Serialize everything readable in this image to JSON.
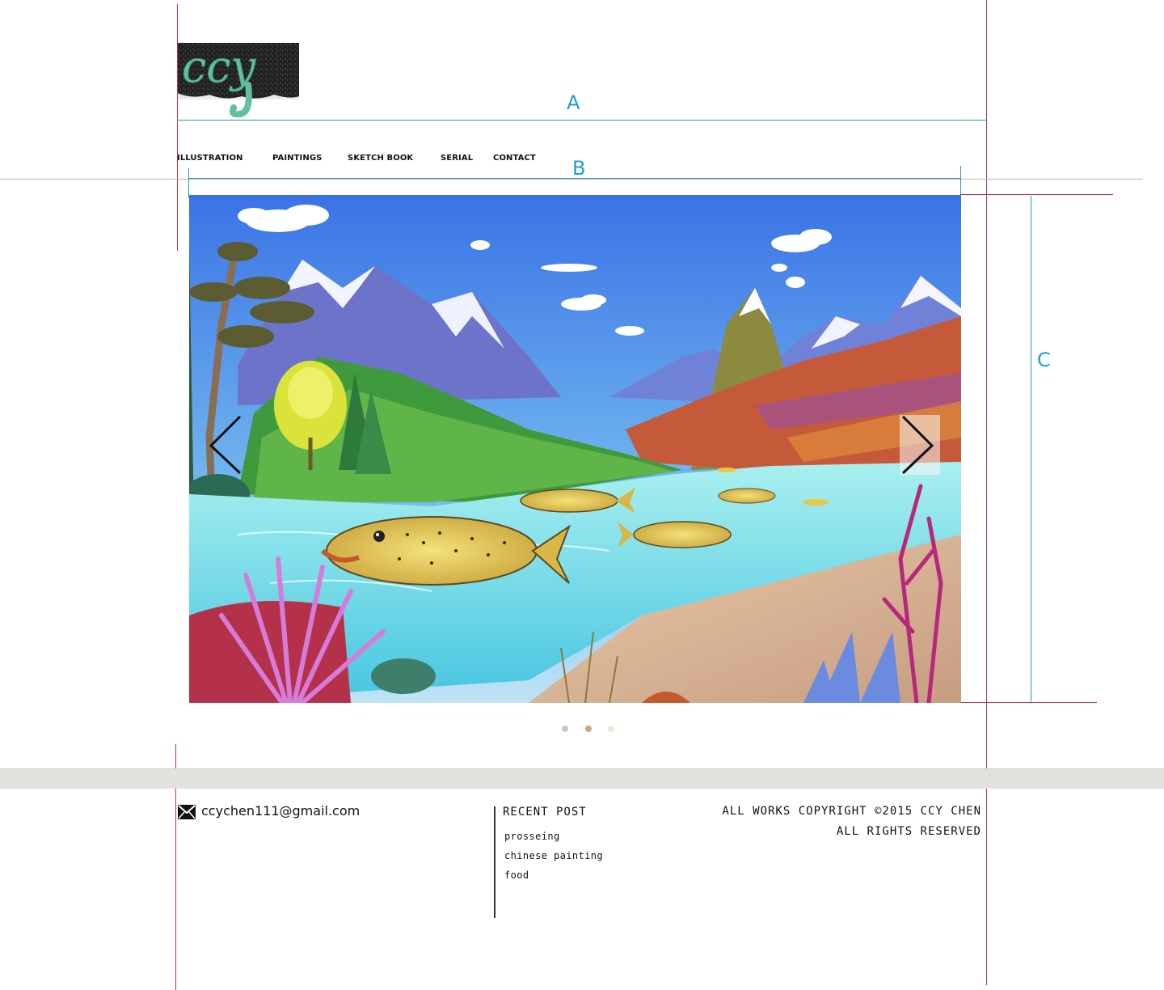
{
  "header": {
    "logo_text": "ccy"
  },
  "guides": {
    "label_a": "A",
    "label_b": "B",
    "label_c": "C"
  },
  "nav": {
    "items": [
      {
        "label": "ILLUSTRATION"
      },
      {
        "label": "PAINTINGS"
      },
      {
        "label": "SKETCH BOOK"
      },
      {
        "label": "SERIAL"
      },
      {
        "label": "CONTACT"
      }
    ]
  },
  "slider": {
    "slide_count": 3,
    "active_index": 1,
    "dot_colors": [
      "#c9c9c9",
      "#c2aa85",
      "#f1e9d8"
    ]
  },
  "footer": {
    "email": "ccychen111@gmail.com",
    "recent_title": "RECENT POST",
    "recent_posts": [
      "prosseing",
      "chinese painting",
      "food"
    ],
    "copyright_line1": "ALL WORKS COPYRIGHT ©2015 CCY CHEN",
    "copyright_line2": "ALL RIGHTS RESERVED"
  },
  "colors": {
    "guide_red": "#c8303a",
    "guide_teal": "#1f9bb3",
    "guide_label": "#1e9ecf",
    "footer_band": "#e2e1dc"
  },
  "icons": [
    "mail-icon",
    "chevron-left-icon",
    "chevron-right-icon"
  ]
}
